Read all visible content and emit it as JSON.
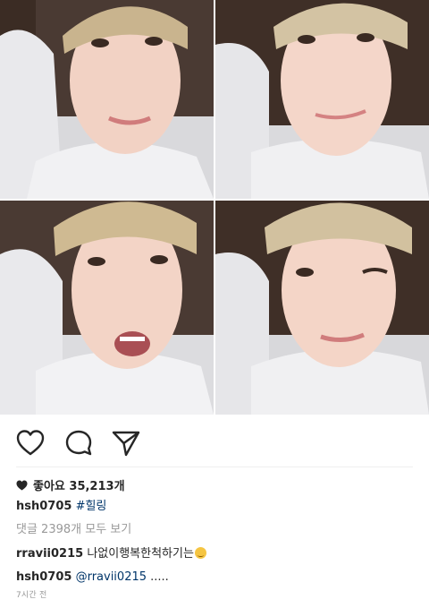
{
  "post": {
    "photos": [
      {
        "expression": "smile"
      },
      {
        "expression": "smirk"
      },
      {
        "expression": "open-mouth"
      },
      {
        "expression": "wink"
      }
    ],
    "actions": {
      "like_icon": "heart-outline-icon",
      "comment_icon": "comment-bubble-icon",
      "share_icon": "send-paper-plane-icon"
    },
    "likes_label": "좋아요 35,213개",
    "caption": {
      "username": "hsh0705",
      "hashtag": "#힐링"
    },
    "view_comments_label": "댓글 2398개 모두 보기",
    "comments": [
      {
        "username": "rravii0215",
        "text": "나없이행복한척하기는"
      },
      {
        "username": "hsh0705",
        "mention": "@rravii0215",
        "text": " ....."
      }
    ],
    "timestamp": "7시간 전"
  },
  "colors": {
    "link": "#003569",
    "muted": "#999999",
    "text": "#262626"
  }
}
